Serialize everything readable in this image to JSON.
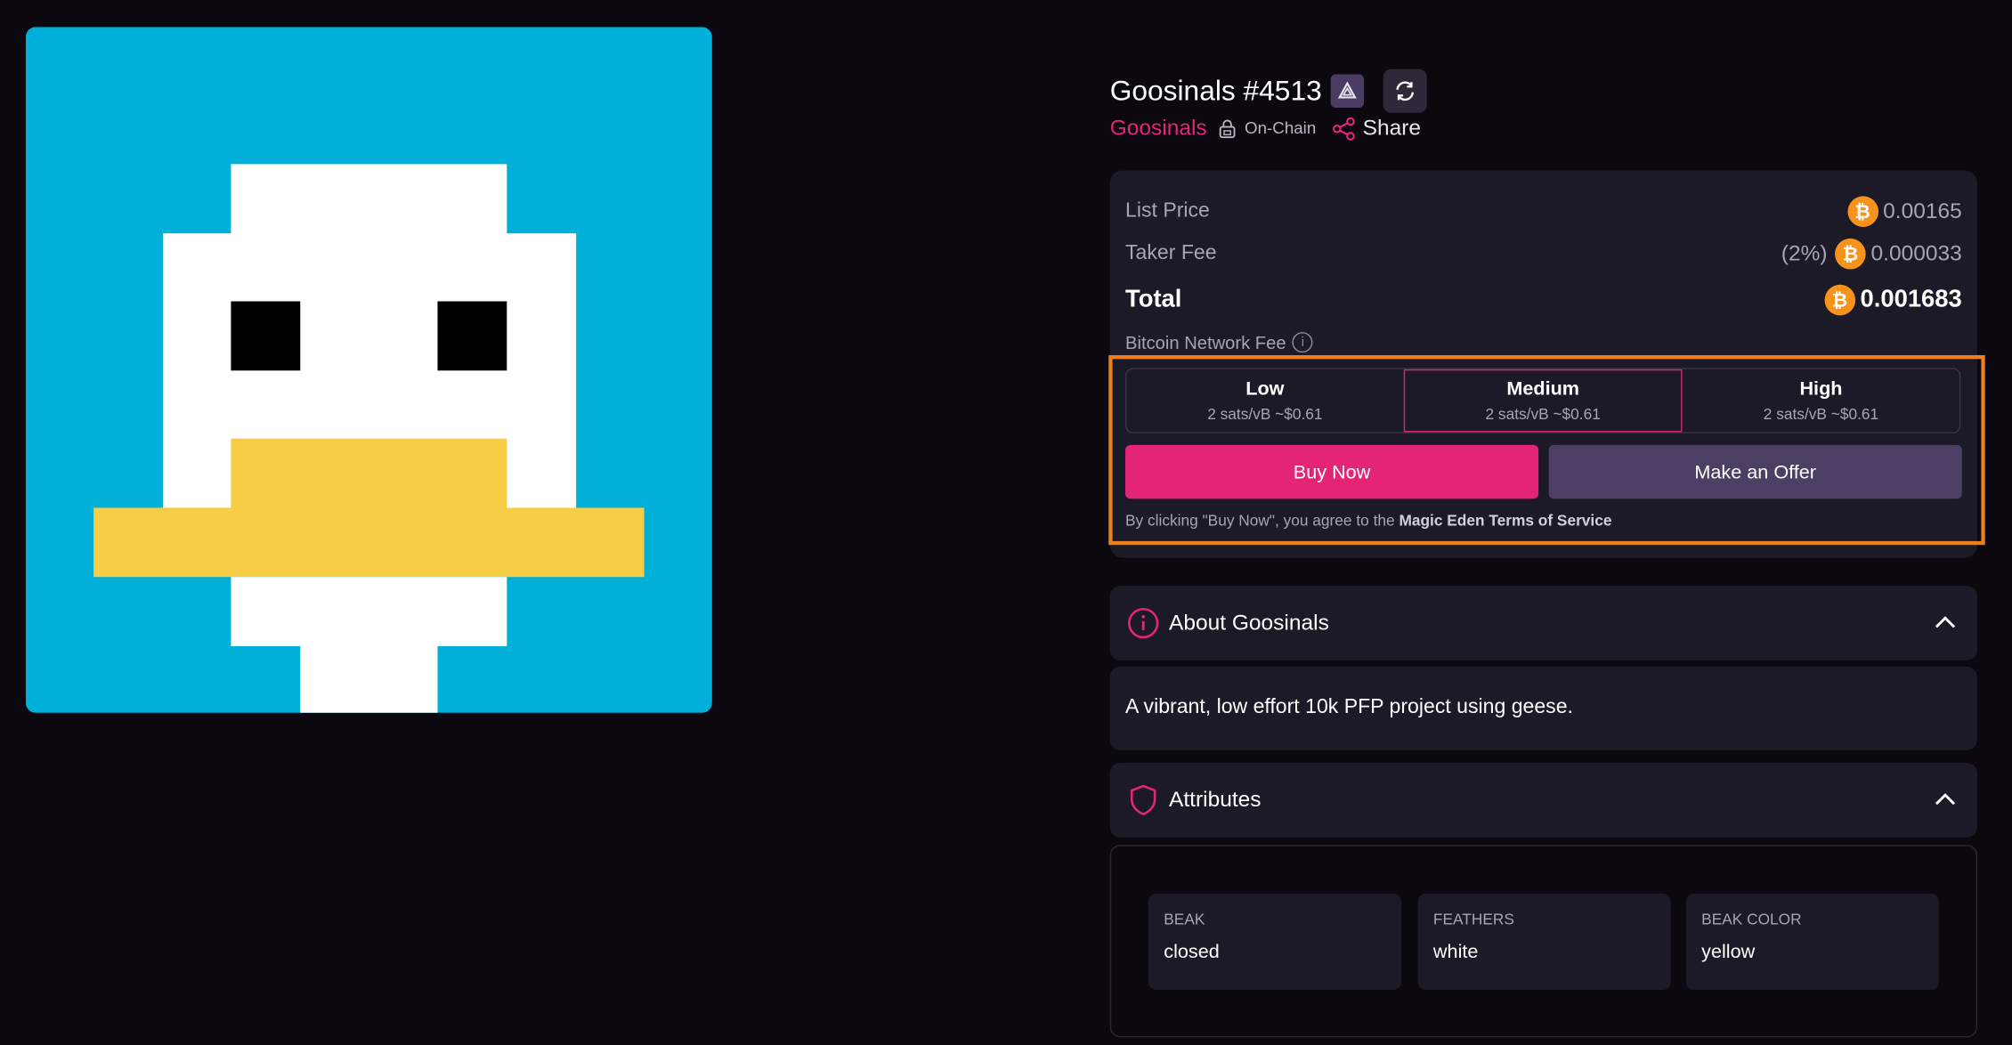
{
  "nft": {
    "title": "Goosinals #4513",
    "collection": "Goosinals",
    "onchain_label": "On-Chain",
    "share_label": "Share",
    "icons": {
      "verify": "ordinals-badge-icon",
      "refresh": "refresh-icon",
      "lock": "lock-icon",
      "share": "share-icon"
    }
  },
  "price": {
    "list_price_label": "List Price",
    "list_price_value": "0.00165",
    "taker_fee_label": "Taker Fee",
    "taker_fee_pct": "(2%)",
    "taker_fee_value": "0.000033",
    "total_label": "Total",
    "total_value": "0.001683",
    "currency_icon": "bitcoin-icon",
    "network_fee_label": "Bitcoin Network Fee",
    "fee_options": [
      {
        "title": "Low",
        "detail": "2 sats/vB ~$0.61"
      },
      {
        "title": "Medium",
        "detail": "2 sats/vB ~$0.61"
      },
      {
        "title": "High",
        "detail": "2 sats/vB ~$0.61"
      }
    ],
    "selected_fee": "Medium",
    "buy_label": "Buy Now",
    "offer_label": "Make an Offer",
    "terms_prefix": "By clicking \"Buy Now\", you agree to the",
    "terms_link": "Magic Eden Terms of Service"
  },
  "about": {
    "title": "About Goosinals",
    "description": "A vibrant, low effort 10k PFP project using geese."
  },
  "attributes": {
    "title": "Attributes",
    "items": [
      {
        "type": "BEAK",
        "value": "closed"
      },
      {
        "type": "FEATHERS",
        "value": "white"
      },
      {
        "type": "BEAK COLOR",
        "value": "yellow"
      }
    ]
  },
  "colors": {
    "accent": "#e42575",
    "highlight": "#f07e1b",
    "art_bg": "#00b0d8",
    "goose_white": "#ffffff",
    "beak_yellow": "#f7cd45"
  }
}
